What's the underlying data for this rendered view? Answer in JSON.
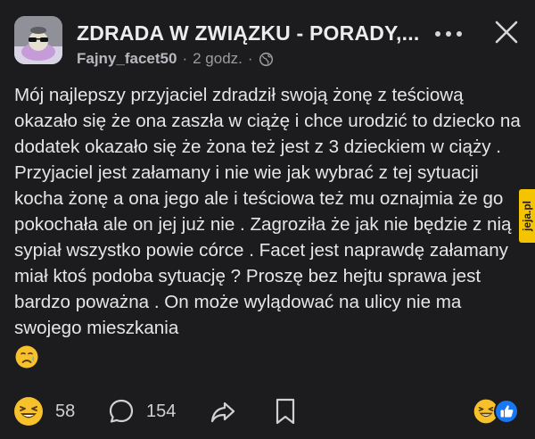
{
  "header": {
    "group_title": "ZDRADA W ZWIĄZKU - PORADY,...",
    "author": "Fajny_facet50",
    "separator": "·",
    "time": "2 godz.",
    "visibility_icon": "globe-icon",
    "more_icon": "more-dots-icon",
    "close_icon": "close-icon"
  },
  "post": {
    "text": "Mój najlepszy przyjaciel zdradził swoją żonę z teściową okazało się że ona zaszła w ciążę i chce urodzić to dziecko na dodatek okazało się że żona też jest z 3 dzieckiem w ciąży . Przyjaciel jest załamany i nie wie jak wybrać z tej sytuacji kocha żonę a ona jego ale i teściowa też mu oznajmia że go pokochała ale on jej już nie . Zagroziła że jak nie będzie z nią sypiał wszystko powie córce . Facet jest naprawdę załamany miał ktoś podoba sytuację ? Proszę bez hejtu sprawa jest bardzo poważna . On może wylądować na ulicy nie ma swojego mieszkania",
    "trailing_emoji": "crying-face-emoji"
  },
  "footer": {
    "reactions_icon": "laughing-face-icon",
    "reactions_count": "58",
    "comments_icon": "comment-bubble-icon",
    "comments_count": "154",
    "share_icon": "share-arrow-icon",
    "save_icon": "bookmark-icon",
    "reaction_summary_icons": [
      "laughing-face-icon",
      "like-thumb-icon"
    ]
  },
  "watermark": {
    "text": "jeja.pl"
  },
  "colors": {
    "background": "#1c1c1e",
    "text": "#e6e6e7",
    "secondary_text": "#9b9ca1",
    "like_blue": "#1877f2",
    "watermark_yellow": "#f4c400"
  }
}
